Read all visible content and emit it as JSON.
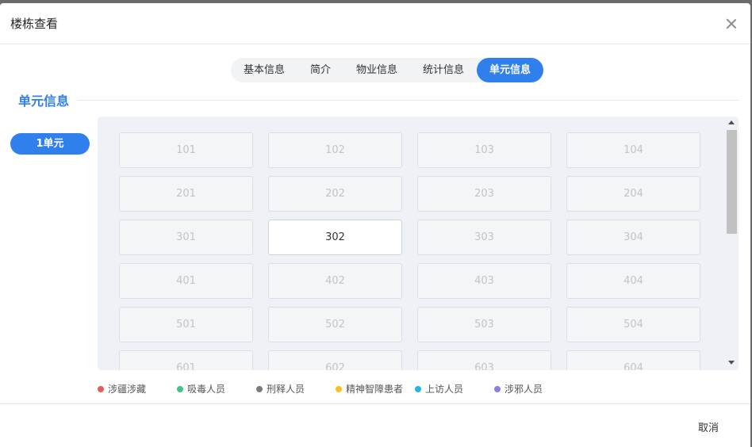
{
  "modal": {
    "title": "楼栋查看",
    "cancel_label": "取消"
  },
  "tabs": [
    {
      "label": "基本信息",
      "active": false
    },
    {
      "label": "简介",
      "active": false
    },
    {
      "label": "物业信息",
      "active": false
    },
    {
      "label": "统计信息",
      "active": false
    },
    {
      "label": "单元信息",
      "active": true
    }
  ],
  "section": {
    "title": "单元信息"
  },
  "units": [
    {
      "label": "1单元",
      "active": true
    }
  ],
  "rooms": [
    "101",
    "102",
    "103",
    "104",
    "201",
    "202",
    "203",
    "204",
    "301",
    "302",
    "303",
    "304",
    "401",
    "402",
    "403",
    "404",
    "501",
    "502",
    "503",
    "504",
    "601",
    "602",
    "603",
    "604"
  ],
  "selected_room": "302",
  "legend": [
    {
      "label": "涉疆涉藏",
      "color": "#e85b5b"
    },
    {
      "label": "吸毒人员",
      "color": "#3cc585"
    },
    {
      "label": "刑释人员",
      "color": "#7a7a7a"
    },
    {
      "label": "精神智障患者",
      "color": "#f5c11b"
    },
    {
      "label": "上访人员",
      "color": "#1fb8e8"
    },
    {
      "label": "涉邪人员",
      "color": "#8a7ee6"
    }
  ],
  "colors": {
    "accent": "#2f80ed"
  }
}
